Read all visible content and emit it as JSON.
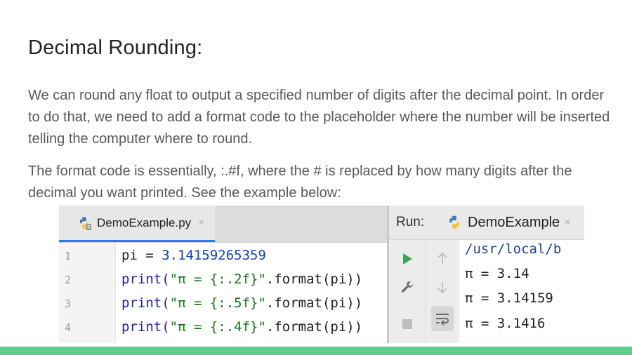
{
  "slide": {
    "title": "Decimal Rounding:",
    "paragraph1": "We can round any float to output a specified number of digits after the decimal point. In order to do that, we need to add a format code to the placeholder where the number will be inserted telling the computer where to round.",
    "paragraph2": "The format code is essentially, :.#f, where the # is replaced by how many digits after the decimal you want printed. See the example below:"
  },
  "editor": {
    "tab_label": "DemoExample.py",
    "close_glyph": "×",
    "lines": [
      {
        "n": "1",
        "segments": [
          {
            "t": "pi = ",
            "k": "plain"
          },
          {
            "t": "3.14159265359",
            "k": "num"
          }
        ]
      },
      {
        "n": "2",
        "segments": [
          {
            "t": "print(",
            "k": "kw"
          },
          {
            "t": "\"π = {:.2f}\"",
            "k": "str"
          },
          {
            "t": ".format(pi))",
            "k": "plain"
          }
        ]
      },
      {
        "n": "3",
        "segments": [
          {
            "t": "print(",
            "k": "kw"
          },
          {
            "t": "\"π = {:.5f}\"",
            "k": "str"
          },
          {
            "t": ".format(pi))",
            "k": "plain"
          }
        ]
      },
      {
        "n": "4",
        "segments": [
          {
            "t": "print(",
            "k": "kw"
          },
          {
            "t": "\"π = {:.4f}\"",
            "k": "str"
          },
          {
            "t": ".format(pi))",
            "k": "plain"
          }
        ]
      }
    ]
  },
  "run_panel": {
    "label": "Run:",
    "tab_label": "DemoExample",
    "close_glyph": "×",
    "output": [
      {
        "text": "/usr/local/b",
        "kind": "path"
      },
      {
        "text": "π = 3.14",
        "kind": "plain"
      },
      {
        "text": "π = 3.14159",
        "kind": "plain"
      },
      {
        "text": "π = 3.1416",
        "kind": "plain"
      }
    ],
    "tools": [
      "play-icon",
      "wrench-icon",
      "stop-icon",
      "up-arrow-icon",
      "down-arrow-icon",
      "soft-wrap-icon"
    ]
  },
  "colors": {
    "bottom_bar": "#60cc8e",
    "tab_underline": "#2a7bf0",
    "play": "#3aa55a",
    "keyword": "#1f1fa8",
    "string": "#0b7a12",
    "number": "#1040c0"
  }
}
